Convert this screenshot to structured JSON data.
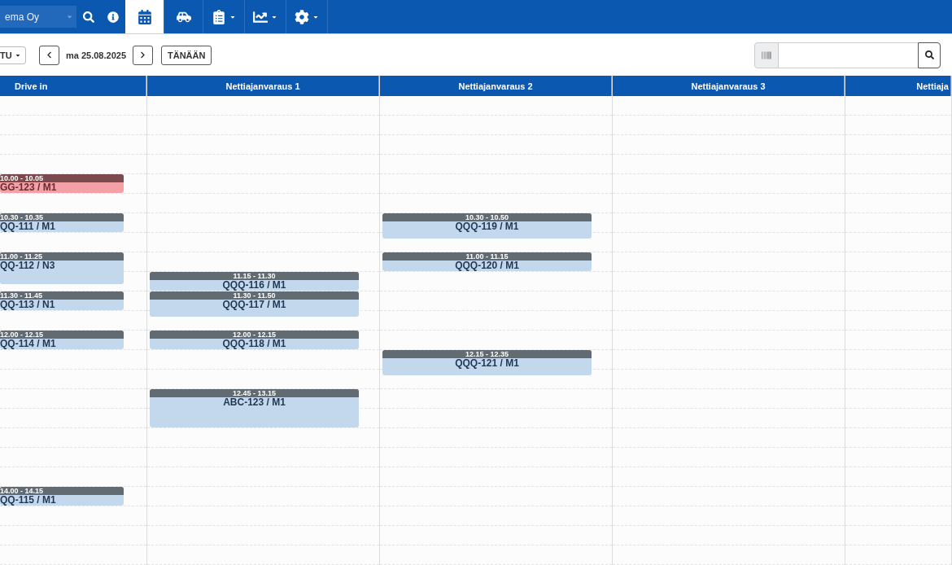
{
  "navbar": {
    "company_select": {
      "value": "ema Oy"
    },
    "items": [
      {
        "kind": "search",
        "selected": false,
        "caret": false
      },
      {
        "kind": "info",
        "selected": false,
        "caret": false
      },
      {
        "kind": "calendar",
        "selected": true,
        "caret": false
      },
      {
        "kind": "car",
        "selected": false,
        "caret": false
      },
      {
        "kind": "clipboard",
        "selected": false,
        "caret": true
      },
      {
        "kind": "chart",
        "selected": false,
        "caret": true
      },
      {
        "kind": "settings",
        "selected": false,
        "caret": true
      }
    ]
  },
  "toolbar": {
    "view_select": {
      "value": "TU"
    },
    "date": "ma 25.08.2025",
    "today_button": "TÄNÄÄN",
    "barcode_search": {
      "kind": "barcode"
    }
  },
  "calendar": {
    "columns": [
      {
        "title": "Drive in",
        "events": [
          {
            "time": "10.00 - 10.05",
            "label": "GG-123 / M1",
            "kind": "alert"
          },
          {
            "time": "10.30 - 10.35",
            "label": "QQ-111 / M1",
            "kind": "normal"
          },
          {
            "time": "11.00 - 11.25",
            "label": "QQ-112 / N3",
            "kind": "normal"
          },
          {
            "time": "11.30 - 11.45",
            "label": "QQ-113 / N1",
            "kind": "normal"
          },
          {
            "time": "12.00 - 12.15",
            "label": "QQ-114 / M1",
            "kind": "normal"
          },
          {
            "time": "14.00 - 14.15",
            "label": "QQ-115 / M1",
            "kind": "normal"
          }
        ]
      },
      {
        "title": "Nettiajanvaraus 1",
        "events": [
          {
            "time": "11.15 - 11.30",
            "label": "QQQ-116 / M1",
            "kind": "normal"
          },
          {
            "time": "11.30 - 11.50",
            "label": "QQQ-117 / M1",
            "kind": "normal"
          },
          {
            "time": "12.00 - 12.15",
            "label": "QQQ-118 / M1",
            "kind": "normal"
          },
          {
            "time": "12.45 - 13.15",
            "label": "ABC-123 / M1",
            "kind": "normal"
          }
        ]
      },
      {
        "title": "Nettiajanvaraus 2",
        "events": [
          {
            "time": "10.30 - 10.50",
            "label": "QQQ-119 / M1",
            "kind": "normal"
          },
          {
            "time": "11.00 - 11.15",
            "label": "QQQ-120 / M1",
            "kind": "normal"
          },
          {
            "time": "12.15 - 12.35",
            "label": "QQQ-121 / M1",
            "kind": "normal"
          }
        ]
      },
      {
        "title": "Nettiajanvaraus 3"
      },
      {
        "title": "Nettiaja"
      }
    ]
  }
}
